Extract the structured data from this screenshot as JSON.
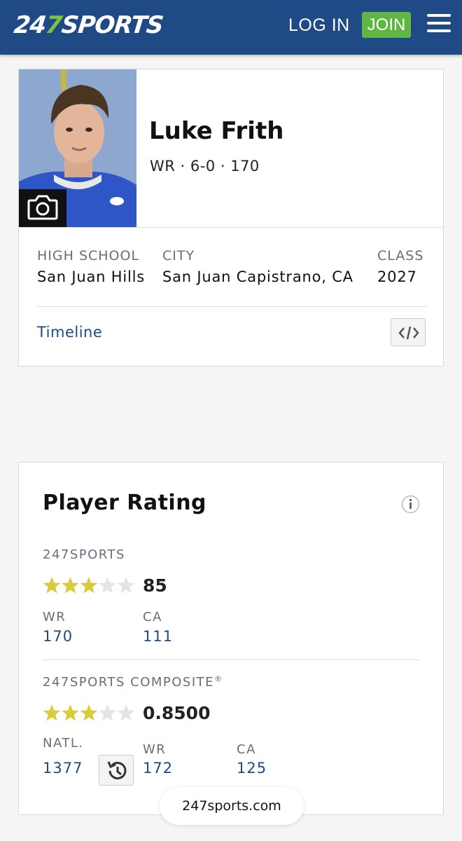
{
  "header": {
    "logo_prefix": "24",
    "logo_seven": "7",
    "logo_suffix": "SPORTS",
    "login_label": "LOG IN",
    "join_label": "JOIN",
    "menu_icon": "hamburger-menu-icon"
  },
  "player": {
    "name": "Luke Frith",
    "meta": "WR · 6-0 · 170",
    "photo_icon": "camera-icon",
    "high_school_label": "HIGH SCHOOL",
    "high_school": "San Juan Hills",
    "city_label": "CITY",
    "city": "San Juan Capistrano, CA",
    "class_label": "CLASS",
    "class_year": "2027",
    "timeline_label": "Timeline",
    "embed_icon": "code-embed-icon"
  },
  "rating": {
    "title": "Player Rating",
    "info_icon": "info-icon",
    "sports247": {
      "label": "247SPORTS",
      "stars": 3,
      "max_stars": 5,
      "score": "85",
      "pos_label": "WR",
      "pos_rank": "170",
      "state_label": "CA",
      "state_rank": "111"
    },
    "composite": {
      "label": "247SPORTS COMPOSITE",
      "reg_mark": "®",
      "stars": 3,
      "max_stars": 5,
      "score": "0.8500",
      "natl_label": "NATL.",
      "natl_rank": "1377",
      "pos_label": "WR",
      "pos_rank": "172",
      "state_label": "CA",
      "state_rank": "125",
      "history_icon": "history-icon"
    }
  },
  "browser": {
    "url": "247sports.com"
  },
  "colors": {
    "brand_blue": "#1f4a86",
    "join_green": "#5fb643",
    "star_gold": "#d8cc3c",
    "star_empty": "#e4e4e4"
  }
}
